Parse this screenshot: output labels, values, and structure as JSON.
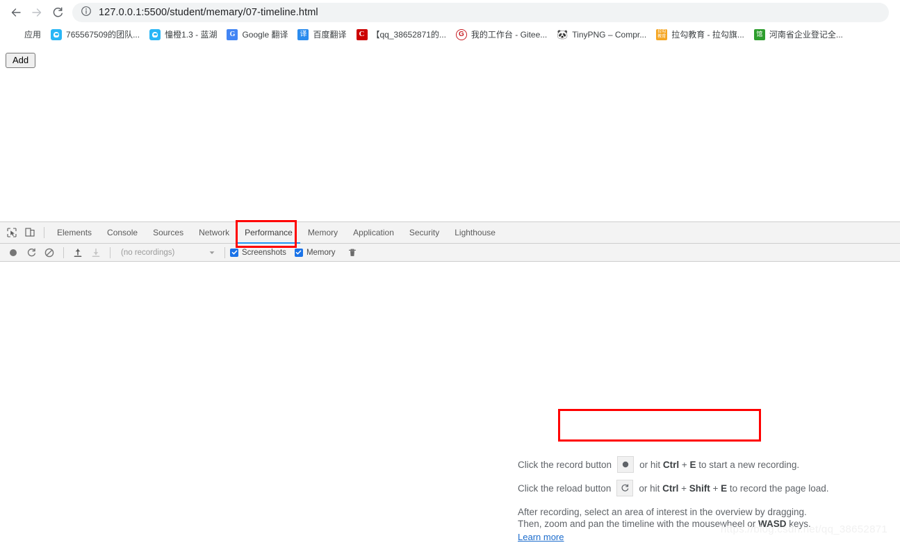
{
  "browser": {
    "nav": {
      "back_icon": "arrow-left-icon",
      "forward_icon": "arrow-right-icon",
      "reload_icon": "reload-icon",
      "info_icon": "info-circle-icon"
    },
    "url": "127.0.0.1:5500/student/memary/07-timeline.html",
    "bookmarks": [
      {
        "label": "应用",
        "icon": "apps-grid-icon",
        "icon_class": "ic-apps",
        "glyph": ""
      },
      {
        "label": "765567509的团队...",
        "icon": "lanhu-icon",
        "icon_class": "ic-lanhu",
        "glyph": ""
      },
      {
        "label": "憧橙1.3 - 蓝湖",
        "icon": "lanhu-icon",
        "icon_class": "ic-lanhu",
        "glyph": ""
      },
      {
        "label": "Google 翻译",
        "icon": "google-translate-icon",
        "icon_class": "ic-gtrans",
        "glyph": "G"
      },
      {
        "label": "百度翻译",
        "icon": "baidu-translate-icon",
        "icon_class": "ic-baidu",
        "glyph": "译"
      },
      {
        "label": "【qq_38652871的...",
        "icon": "csdn-icon",
        "icon_class": "ic-csdn",
        "glyph": "C"
      },
      {
        "label": "我的工作台 - Gitee...",
        "icon": "gitee-icon",
        "icon_class": "ic-gitee",
        "glyph": "G"
      },
      {
        "label": "TinyPNG – Compr...",
        "icon": "tinypng-panda-icon",
        "icon_class": "ic-tinypng",
        "glyph": "🐼"
      },
      {
        "label": "拉勾教育 - 拉勾旗...",
        "icon": "lagou-icon",
        "icon_class": "ic-lagou",
        "glyph": "拉勾教育"
      },
      {
        "label": "河南省企业登记全...",
        "icon": "henan-icon",
        "icon_class": "ic-henan",
        "glyph": "馆"
      }
    ]
  },
  "page": {
    "add_button_label": "Add"
  },
  "devtools": {
    "inspect_icon": "inspect-element-icon",
    "device_toggle_icon": "device-toolbar-icon",
    "tabs": [
      {
        "label": "Elements",
        "active": false
      },
      {
        "label": "Console",
        "active": false
      },
      {
        "label": "Sources",
        "active": false
      },
      {
        "label": "Network",
        "active": false
      },
      {
        "label": "Performance",
        "active": true
      },
      {
        "label": "Memory",
        "active": false
      },
      {
        "label": "Application",
        "active": false
      },
      {
        "label": "Security",
        "active": false
      },
      {
        "label": "Lighthouse",
        "active": false
      }
    ],
    "active_tab": "Performance",
    "toolbar": {
      "record_icon": "record-circle-icon",
      "reload_record_icon": "reload-record-icon",
      "clear_icon": "clear-prohibited-icon",
      "load_profile_icon": "upload-arrow-icon",
      "save_profile_icon": "download-arrow-icon",
      "recordings_value": "(no recordings)",
      "dropdown_icon": "chevron-down-icon",
      "screenshots_label": "Screenshots",
      "screenshots_checked": true,
      "memory_label": "Memory",
      "memory_checked": true,
      "trash_icon": "trash-icon",
      "checkbox_color": "#1a73e8"
    },
    "instructions": {
      "record_line_pre": "Click the record button",
      "record_line_mid": "or hit",
      "record_key_1": "Ctrl",
      "record_key_plus": "+",
      "record_key_2": "E",
      "record_line_post": "to start a new recording.",
      "reload_line_pre": "Click the reload button",
      "reload_line_mid": "or hit",
      "reload_key_1": "Ctrl",
      "reload_key_2": "Shift",
      "reload_key_3": "E",
      "reload_line_post": "to record the page load.",
      "paragraph_line_1": "After recording, select an area of interest in the overview by dragging.",
      "paragraph_line_2_pre": "Then, zoom and pan the timeline with the mousewheel or",
      "paragraph_line_2_key": "WASD",
      "paragraph_line_2_post": "keys.",
      "learn_more_label": "Learn more",
      "record_button_icon": "record-circle-icon",
      "reload_button_icon": "reload-icon"
    }
  },
  "annotations": {
    "highlight_color": "#ff0000",
    "performance_tab_highlight": "Performance",
    "record_button_highlight": "record button row"
  },
  "watermark": {
    "text": "https://blog.csdn.net/qq_38652871"
  }
}
